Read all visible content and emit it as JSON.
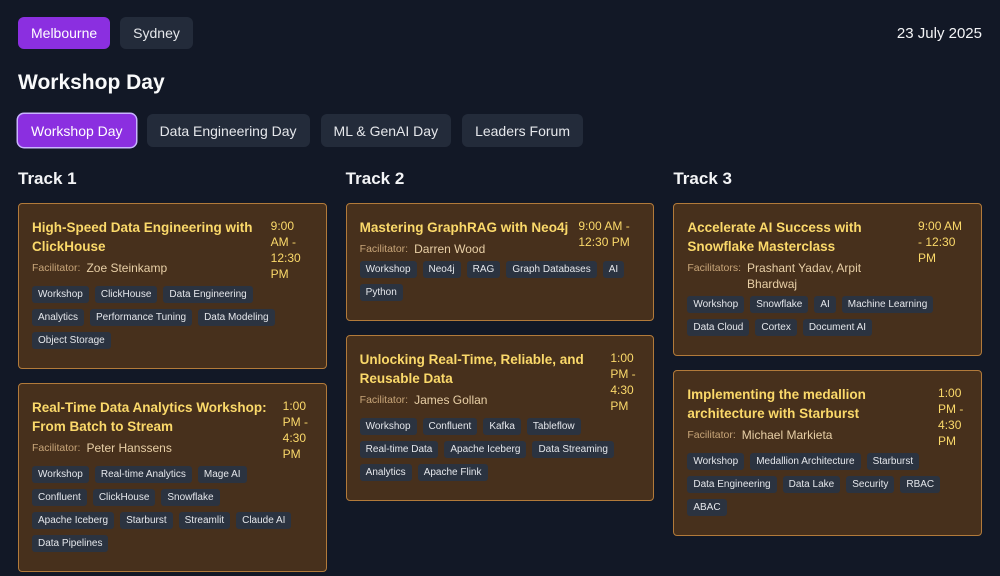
{
  "cities": [
    {
      "label": "Melbourne",
      "active": true
    },
    {
      "label": "Sydney",
      "active": false
    }
  ],
  "date": "23 July 2025",
  "page_title": "Workshop Day",
  "day_tabs": [
    {
      "label": "Workshop Day",
      "active": true
    },
    {
      "label": "Data Engineering Day",
      "active": false
    },
    {
      "label": "ML & GenAI Day",
      "active": false
    },
    {
      "label": "Leaders Forum",
      "active": false
    }
  ],
  "tracks": [
    {
      "title": "Track 1",
      "sessions": [
        {
          "title": "High-Speed Data Engineering with ClickHouse",
          "time": "9:00 AM - 12:30 PM",
          "facilitator_label": "Facilitator:",
          "facilitator": "Zoe Steinkamp",
          "tags": [
            "Workshop",
            "ClickHouse",
            "Data Engineering",
            "Analytics",
            "Performance Tuning",
            "Data Modeling",
            "Object Storage"
          ]
        },
        {
          "title": "Real-Time Data Analytics Workshop: From Batch to Stream",
          "time": "1:00 PM - 4:30 PM",
          "facilitator_label": "Facilitator:",
          "facilitator": "Peter Hanssens",
          "tags": [
            "Workshop",
            "Real-time Analytics",
            "Mage AI",
            "Confluent",
            "ClickHouse",
            "Snowflake",
            "Apache Iceberg",
            "Starburst",
            "Streamlit",
            "Claude AI",
            "Data Pipelines"
          ]
        }
      ]
    },
    {
      "title": "Track 2",
      "sessions": [
        {
          "title": "Mastering GraphRAG with Neo4j",
          "time": "9:00 AM - 12:30 PM",
          "facilitator_label": "Facilitator:",
          "facilitator": "Darren Wood",
          "tags": [
            "Workshop",
            "Neo4j",
            "RAG",
            "Graph Databases",
            "AI",
            "Python"
          ]
        },
        {
          "title": "Unlocking Real-Time, Reliable, and Reusable Data",
          "time": "1:00 PM - 4:30 PM",
          "facilitator_label": "Facilitator:",
          "facilitator": "James Gollan",
          "tags": [
            "Workshop",
            "Confluent",
            "Kafka",
            "Tableflow",
            "Real-time Data",
            "Apache Iceberg",
            "Data Streaming",
            "Analytics",
            "Apache Flink"
          ]
        }
      ]
    },
    {
      "title": "Track 3",
      "sessions": [
        {
          "title": "Accelerate AI Success with Snowflake Masterclass",
          "time": "9:00 AM - 12:30 PM",
          "facilitator_label": "Facilitators:",
          "facilitator": "Prashant Yadav, Arpit Bhardwaj",
          "tags": [
            "Workshop",
            "Snowflake",
            "AI",
            "Machine Learning",
            "Data Cloud",
            "Cortex",
            "Document AI"
          ]
        },
        {
          "title": "Implementing the medallion architecture with Starburst",
          "time": "1:00 PM - 4:30 PM",
          "facilitator_label": "Facilitator:",
          "facilitator": "Michael Markieta",
          "tags": [
            "Workshop",
            "Medallion Architecture",
            "Starburst",
            "Data Engineering",
            "Data Lake",
            "Security",
            "RBAC",
            "ABAC"
          ]
        }
      ]
    }
  ]
}
